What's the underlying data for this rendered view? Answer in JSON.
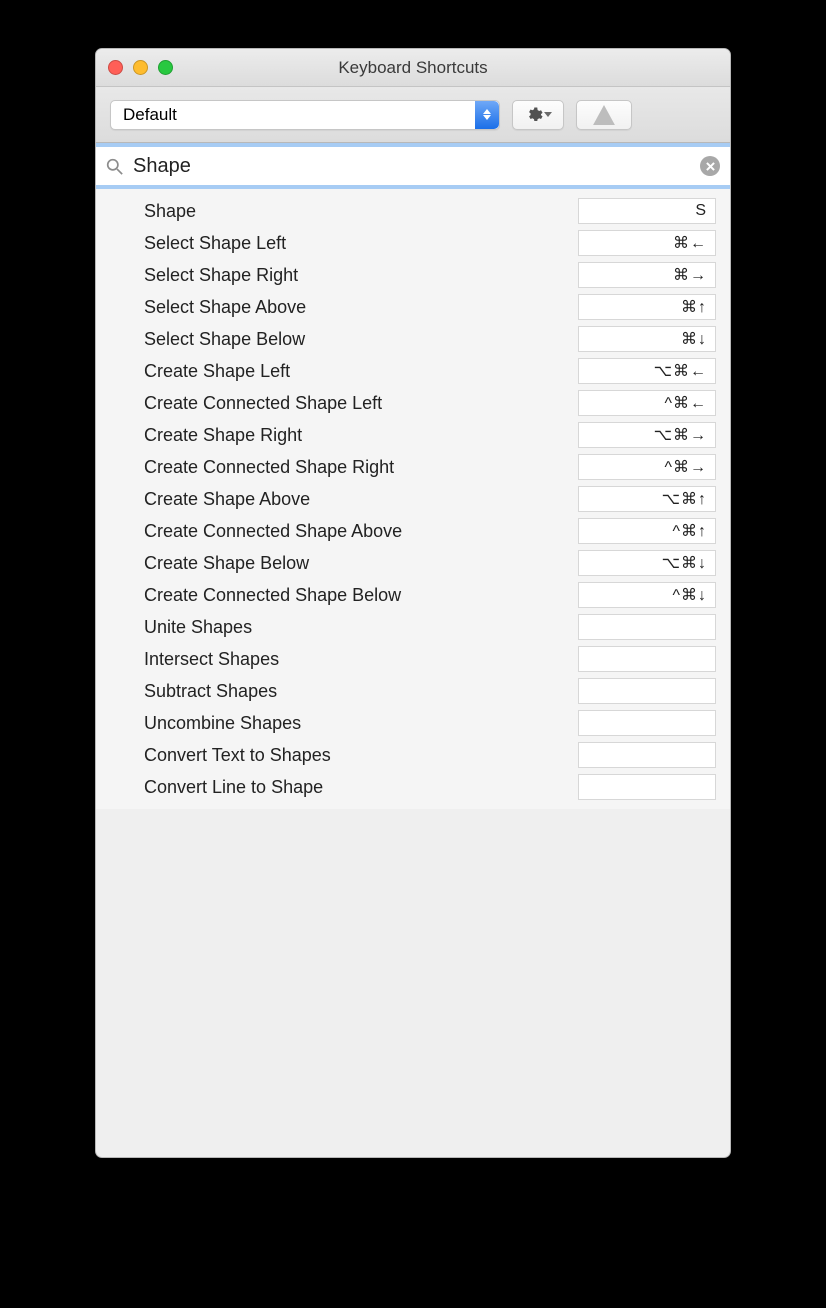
{
  "window": {
    "title": "Keyboard Shortcuts"
  },
  "toolbar": {
    "preset_selected": "Default"
  },
  "search": {
    "value": "Shape"
  },
  "shortcuts": [
    {
      "label": "Shape",
      "keys": "S"
    },
    {
      "label": "Select Shape Left",
      "keys": "⌘←"
    },
    {
      "label": "Select Shape Right",
      "keys": "⌘→"
    },
    {
      "label": "Select Shape Above",
      "keys": "⌘↑"
    },
    {
      "label": "Select Shape Below",
      "keys": "⌘↓"
    },
    {
      "label": "Create Shape Left",
      "keys": "⌥⌘←"
    },
    {
      "label": "Create Connected Shape Left",
      "keys": "^⌘←"
    },
    {
      "label": "Create Shape Right",
      "keys": "⌥⌘→"
    },
    {
      "label": "Create Connected Shape Right",
      "keys": "^⌘→"
    },
    {
      "label": "Create Shape Above",
      "keys": "⌥⌘↑"
    },
    {
      "label": "Create Connected Shape Above",
      "keys": "^⌘↑"
    },
    {
      "label": "Create Shape Below",
      "keys": "⌥⌘↓"
    },
    {
      "label": "Create Connected Shape Below",
      "keys": "^⌘↓"
    },
    {
      "label": "Unite Shapes",
      "keys": ""
    },
    {
      "label": "Intersect Shapes",
      "keys": ""
    },
    {
      "label": "Subtract Shapes",
      "keys": ""
    },
    {
      "label": "Uncombine Shapes",
      "keys": ""
    },
    {
      "label": "Convert Text to Shapes",
      "keys": ""
    },
    {
      "label": "Convert Line to Shape",
      "keys": ""
    }
  ]
}
